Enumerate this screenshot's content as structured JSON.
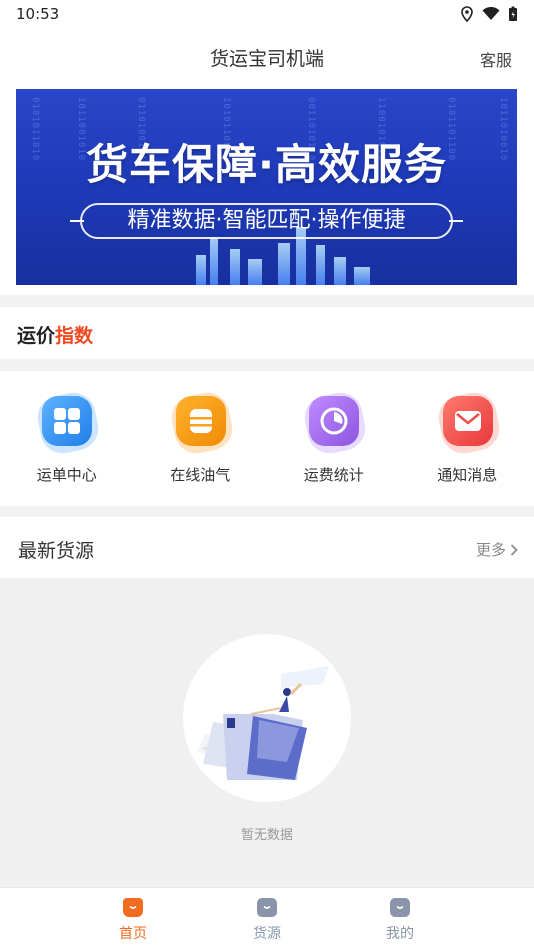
{
  "status": {
    "time": "10:53"
  },
  "nav": {
    "title": "货运宝司机端",
    "service": "客服"
  },
  "banner": {
    "title": "货车保障·高效服务",
    "subtitle": "精准数据·智能匹配·操作便捷"
  },
  "price_index": {
    "part1": "运价",
    "part2": "指数"
  },
  "menu": [
    {
      "label": "运单中心",
      "icon": "grid-icon",
      "color": "#2e8bf0"
    },
    {
      "label": "在线油气",
      "icon": "oil-drum-icon",
      "color": "#f59a0c"
    },
    {
      "label": "运费统计",
      "icon": "pie-chart-icon",
      "color": "#9a66e6"
    },
    {
      "label": "通知消息",
      "icon": "envelope-icon",
      "color": "#f04a45"
    }
  ],
  "latest": {
    "title": "最新货源",
    "more": "更多"
  },
  "empty": {
    "text": "暂无数据"
  },
  "tabs": [
    {
      "label": "首页",
      "icon": "home-icon",
      "active": true
    },
    {
      "label": "货源",
      "icon": "cargo-icon",
      "active": false
    },
    {
      "label": "我的",
      "icon": "profile-icon",
      "active": false
    }
  ],
  "colors": {
    "accent": "#f04a23",
    "tab_active": "#f26b21",
    "tab_inactive": "#8a95aa"
  }
}
